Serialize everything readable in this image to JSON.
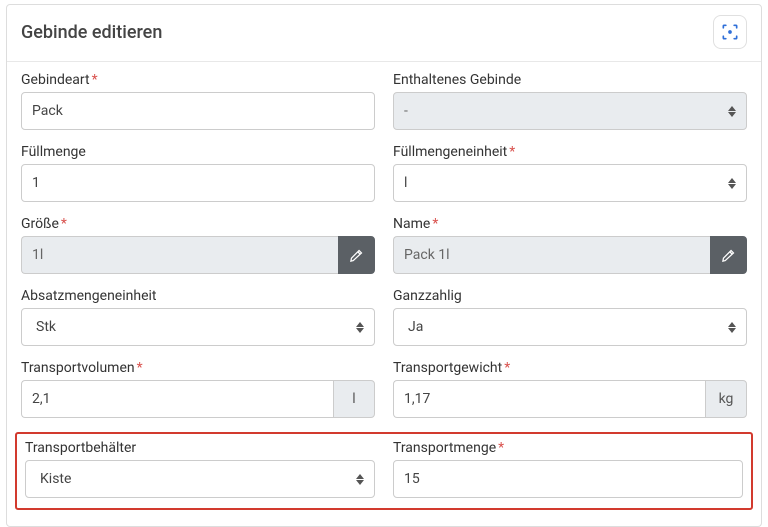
{
  "header": {
    "title": "Gebinde editieren"
  },
  "fields": {
    "gebindeart": {
      "label": "Gebindeart",
      "required": true,
      "value": "Pack"
    },
    "enthaltenes": {
      "label": "Enthaltenes Gebinde",
      "required": false,
      "value": "-"
    },
    "fuellmenge": {
      "label": "Füllmenge",
      "required": false,
      "value": "1"
    },
    "fuellmengeneinheit": {
      "label": "Füllmengeneinheit",
      "required": true,
      "value": "l"
    },
    "groesse": {
      "label": "Größe",
      "required": true,
      "value": "1l"
    },
    "name": {
      "label": "Name",
      "required": true,
      "value": "Pack 1l"
    },
    "absatz": {
      "label": "Absatzmengeneinheit",
      "required": false,
      "value": "Stk"
    },
    "ganzzahlig": {
      "label": "Ganzzahlig",
      "required": false,
      "value": "Ja"
    },
    "transportvolumen": {
      "label": "Transportvolumen",
      "required": true,
      "value": "2,1",
      "unit": "l"
    },
    "transportgewicht": {
      "label": "Transportgewicht",
      "required": true,
      "value": "1,17",
      "unit": "kg"
    },
    "transportbehaelter": {
      "label": "Transportbehälter",
      "required": false,
      "value": "Kiste"
    },
    "transportmenge": {
      "label": "Transportmenge",
      "required": true,
      "value": "15"
    }
  },
  "required_marker": "*"
}
